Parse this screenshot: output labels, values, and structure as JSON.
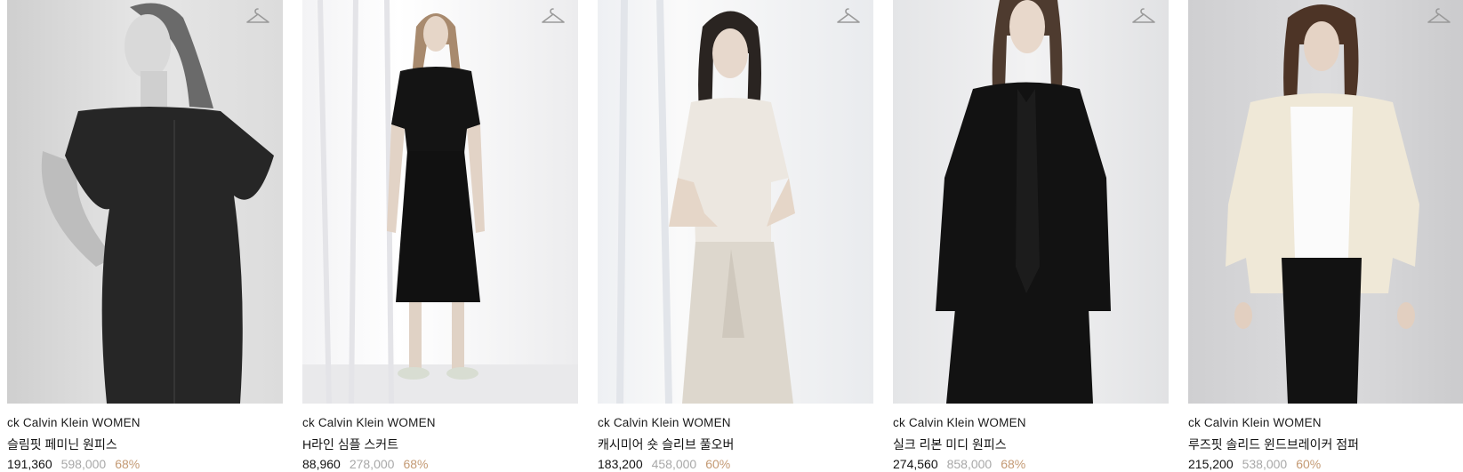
{
  "products": [
    {
      "brand": "ck Calvin Klein WOMEN",
      "name": "슬림핏 페미닌 원피스",
      "price": "191,360",
      "original_price": "598,000",
      "discount": "68%",
      "icon": "hanger-icon"
    },
    {
      "brand": "ck Calvin Klein WOMEN",
      "name": "H라인 심플 스커트",
      "price": "88,960",
      "original_price": "278,000",
      "discount": "68%",
      "icon": "hanger-icon"
    },
    {
      "brand": "ck Calvin Klein WOMEN",
      "name": "캐시미어 숏 슬리브 풀오버",
      "price": "183,200",
      "original_price": "458,000",
      "discount": "60%",
      "icon": "hanger-icon"
    },
    {
      "brand": "ck Calvin Klein WOMEN",
      "name": "실크 리본 미디 원피스",
      "price": "274,560",
      "original_price": "858,000",
      "discount": "68%",
      "icon": "hanger-icon"
    },
    {
      "brand": "ck Calvin Klein WOMEN",
      "name": "루즈핏 솔리드 윈드브레이커 점퍼",
      "price": "215,200",
      "original_price": "538,000",
      "discount": "60%",
      "icon": "hanger-icon"
    }
  ],
  "colors": {
    "price": "#111111",
    "original_price": "#a8a8a8",
    "discount": "#c49a74"
  }
}
